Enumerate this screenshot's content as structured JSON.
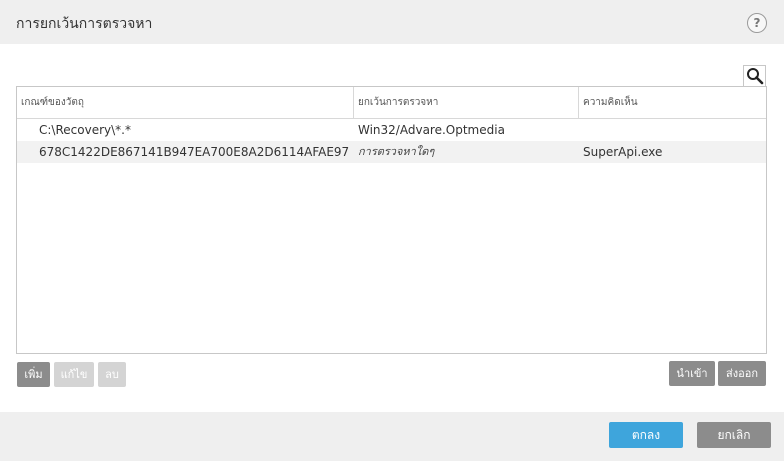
{
  "dialog": {
    "title": "การยกเว้นการตรวจหา",
    "help_label": "?"
  },
  "search": {
    "icon": "search-icon"
  },
  "table": {
    "columns": [
      "เกณฑ์ของวัตถุ",
      "ยกเว้นการตรวจหา",
      "ความคิดเห็น"
    ],
    "rows": [
      {
        "criteria": "C:\\Recovery\\*.*",
        "detection": "Win32/Advare.Optmedia",
        "comment": ""
      },
      {
        "criteria": "678C1422DE867141B947EA700E8A2D6114AFAE97",
        "detection": "การตรวจหาใดๆ",
        "comment": "SuperApi.exe"
      }
    ]
  },
  "actions": {
    "add": "เพิ่ม",
    "edit": "แก้ไข",
    "delete": "ลบ",
    "import": "นำเข้า",
    "export": "ส่งออก"
  },
  "footer": {
    "ok": "ตกลง",
    "cancel": "ยกเลิก"
  }
}
